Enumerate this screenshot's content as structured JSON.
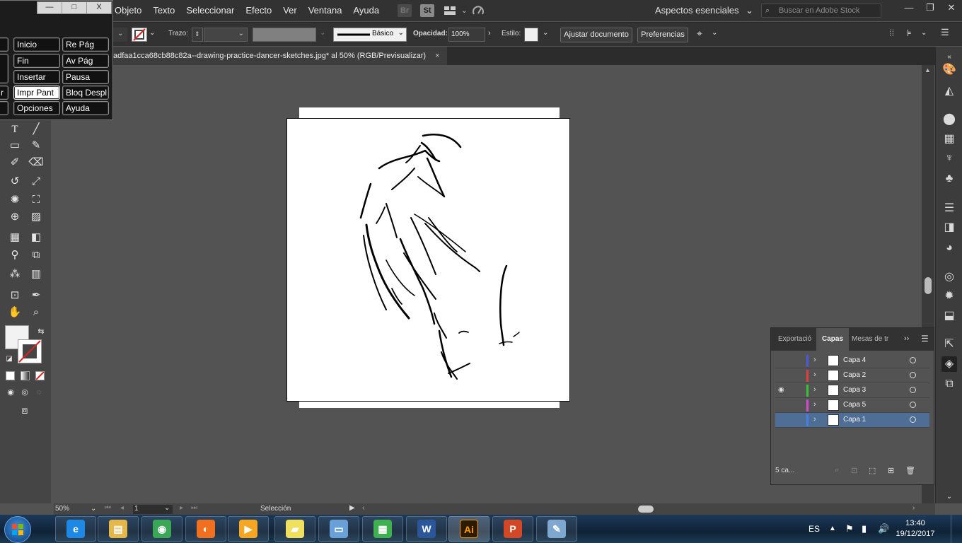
{
  "menubar": {
    "items": [
      "Objeto",
      "Texto",
      "Seleccionar",
      "Efecto",
      "Ver",
      "Ventana",
      "Ayuda"
    ],
    "icons": [
      "bridge-icon",
      "stock-icon",
      "arrange-documents-icon",
      "gpu-performance-icon"
    ],
    "br_label": "Br",
    "st_label": "St",
    "workspace_label": "Aspectos esenciales",
    "stock_search_placeholder": "Buscar en Adobe Stock",
    "window_controls": [
      "—",
      "❐",
      "✕"
    ]
  },
  "controlbar": {
    "trazo_label": "Trazo:",
    "stroke_profile": "Básico",
    "opacity_label": "Opacidad:",
    "opacity_value": "100%",
    "style_label": "Estilo:",
    "adjust_document_label": "Ajustar documento",
    "preferences_label": "Preferencias"
  },
  "document": {
    "tab_title": "adfaa1cca68cb88c82a--drawing-practice-dancer-sketches.jpg* al 50% (RGB/Previsualizar)",
    "close_glyph": "×"
  },
  "osk": {
    "title_buttons": [
      "—",
      "□",
      "X"
    ],
    "keys": [
      {
        "label": "Inicio",
        "active": false
      },
      {
        "label": "Re Pág",
        "active": false
      },
      {
        "label": "Fin",
        "active": false
      },
      {
        "label": "Av Pág",
        "active": false
      },
      {
        "label": "Insertar",
        "active": false
      },
      {
        "label": "Pausa",
        "active": false
      },
      {
        "label": "r",
        "active": false
      },
      {
        "label": "Impr Pant",
        "active": true
      },
      {
        "label": "Bloq Despl",
        "active": false
      },
      {
        "label": "Opciones",
        "active": false
      },
      {
        "label": "Ayuda",
        "active": false
      }
    ]
  },
  "layers_panel": {
    "tabs": [
      "Exportació",
      "Capas",
      "Mesas de tr"
    ],
    "active_tab": "Capas",
    "layers": [
      {
        "name": "Capa 4",
        "color": "#4a5bd9",
        "visible": false,
        "selected": false
      },
      {
        "name": "Capa 2",
        "color": "#e04040",
        "visible": false,
        "selected": false
      },
      {
        "name": "Capa 3",
        "color": "#3ec23e",
        "visible": true,
        "selected": false
      },
      {
        "name": "Capa 5",
        "color": "#d24bd2",
        "visible": false,
        "selected": false
      },
      {
        "name": "Capa 1",
        "color": "#4a7ee0",
        "visible": false,
        "selected": true
      }
    ],
    "footer_count": "5 ca..."
  },
  "statusbar": {
    "zoom": "50%",
    "page": "1",
    "status": "Selección"
  },
  "taskbar": {
    "apps": [
      {
        "name": "internet-explorer",
        "glyph": "e",
        "color": "#1e88e5"
      },
      {
        "name": "file-explorer",
        "glyph": "▤",
        "color": "#e5b84a"
      },
      {
        "name": "chrome",
        "glyph": "◉",
        "color": "#3aa757"
      },
      {
        "name": "firefox",
        "glyph": "◐",
        "color": "#f07020"
      },
      {
        "name": "media-player",
        "glyph": "▶",
        "color": "#f5a623"
      },
      {
        "name": "sticky-notes",
        "glyph": "▰",
        "color": "#f0e060"
      },
      {
        "name": "remote-desktop",
        "glyph": "▭",
        "color": "#6aa0d8"
      },
      {
        "name": "calculator-app",
        "glyph": "▦",
        "color": "#3fb04f"
      },
      {
        "name": "word",
        "glyph": "W",
        "color": "#2b579a"
      },
      {
        "name": "illustrator",
        "glyph": "Ai",
        "color": "#ff9a00"
      },
      {
        "name": "powerpoint",
        "glyph": "P",
        "color": "#d24726"
      },
      {
        "name": "paint",
        "glyph": "✎",
        "color": "#7fa8d0"
      }
    ],
    "language": "ES",
    "time": "13:40",
    "date": "19/12/2017"
  }
}
